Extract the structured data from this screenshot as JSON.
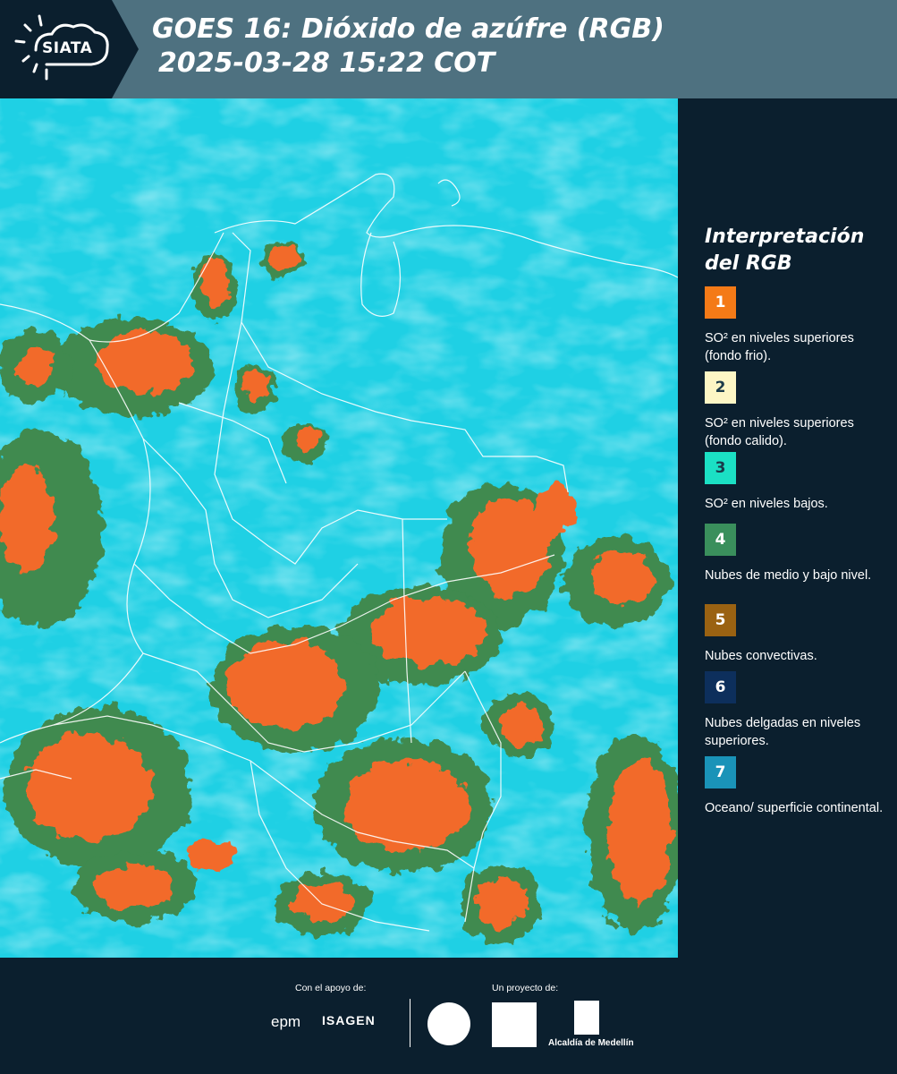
{
  "header": {
    "title": "GOES 16: Dióxido de azúfre (RGB)",
    "subtitle": "2025-03-28 15:22 COT",
    "logo_text": "SIATA"
  },
  "legend": {
    "title_line1": "Interpretación",
    "title_line2": "del RGB",
    "items": [
      {
        "number": "1",
        "label": "SO² en niveles superiores (fondo frio).",
        "color": "#f47a17"
      },
      {
        "number": "2",
        "label": "SO² en niveles superiores (fondo calido).",
        "color": "#fdf6c5"
      },
      {
        "number": "3",
        "label": "SO² en niveles bajos.",
        "color": "#1be0c4"
      },
      {
        "number": "4",
        "label": "Nubes de medio y bajo nivel.",
        "color": "#3a8f5c"
      },
      {
        "number": "5",
        "label": "Nubes convectivas.",
        "color": "#9a6212"
      },
      {
        "number": "6",
        "label": "Nubes delgadas en niveles superiores.",
        "color": "#0d2f5c"
      },
      {
        "number": "7",
        "label": "Oceano/ superficie continental.",
        "color": "#1a93b8"
      }
    ]
  },
  "footer": {
    "support_label": "Con el apoyo de:",
    "project_label": "Un proyecto de:",
    "epm": "epm",
    "isagen": "ISAGEN",
    "alcaldia": "Alcaldía de Medellín"
  },
  "colors": {
    "background": "#0b1f2e",
    "header": "#4e7180",
    "sky": "#1fd0e4",
    "cloud_orange": "#f26b2a",
    "cloud_green": "#3f8a4f"
  }
}
